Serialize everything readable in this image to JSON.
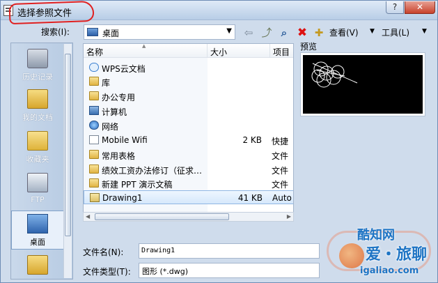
{
  "window": {
    "title": "选择参照文件"
  },
  "titlebar_buttons": {
    "help": "?",
    "close": "✕"
  },
  "toolbar": {
    "lookin_label": "搜索(I):",
    "lookin_value": "桌面",
    "view_label": "查看(V)",
    "tools_label": "工具(L)"
  },
  "places": [
    {
      "label": "历史记录"
    },
    {
      "label": "我的文档"
    },
    {
      "label": "收藏夹"
    },
    {
      "label": "FTP"
    },
    {
      "label": "桌面"
    }
  ],
  "filelist": {
    "columns": [
      "名称",
      "大小",
      "项目"
    ],
    "rows": [
      {
        "icon": "cloud-icon",
        "name": "WPS云文档",
        "size": "",
        "type": ""
      },
      {
        "icon": "folder-icon",
        "name": "库",
        "size": "",
        "type": ""
      },
      {
        "icon": "folder-icon",
        "name": "办公专用",
        "size": "",
        "type": ""
      },
      {
        "icon": "computer-icon",
        "name": "计算机",
        "size": "",
        "type": ""
      },
      {
        "icon": "network-icon",
        "name": "网络",
        "size": "",
        "type": ""
      },
      {
        "icon": "shortcut-icon",
        "name": "Mobile Wifi",
        "size": "2 KB",
        "type": "快捷"
      },
      {
        "icon": "folder-icon",
        "name": "常用表格",
        "size": "",
        "type": "文件"
      },
      {
        "icon": "folder-icon",
        "name": "绩效工资办法修订（征求…",
        "size": "",
        "type": "文件"
      },
      {
        "icon": "folder-icon",
        "name": "新建 PPT 演示文稿",
        "size": "",
        "type": "文件"
      },
      {
        "icon": "dwg-file-icon",
        "name": "Drawing1",
        "size": "41 KB",
        "type": "Auto"
      }
    ],
    "selected_index": 9
  },
  "preview": {
    "label": "预览"
  },
  "form": {
    "filename_label": "文件名(N):",
    "filename_value": "Drawing1",
    "filetype_label": "文件类型(T):",
    "filetype_value": "图形 (*.dwg)"
  },
  "watermark": {
    "line1": "酷知网",
    "line2": "爱・旅聊",
    "url": "igaliao.com"
  },
  "colors": {
    "accent": "#1e74c4",
    "highlight": "#e02020",
    "selection": "#d6e8fb"
  }
}
